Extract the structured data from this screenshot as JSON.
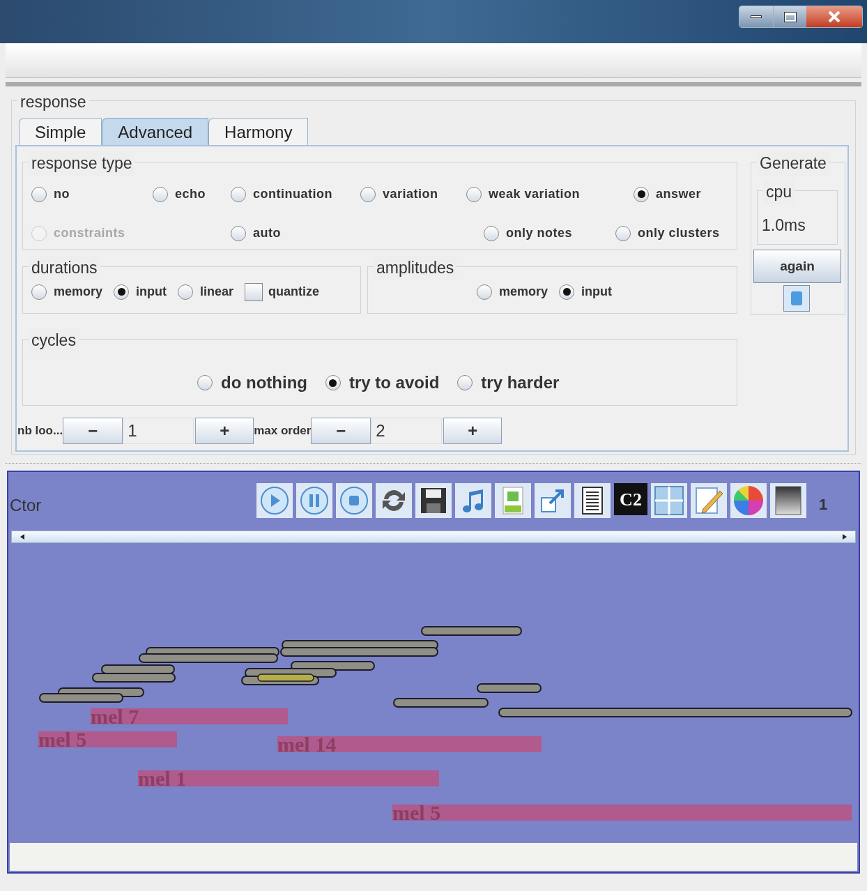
{
  "response": {
    "title": "response",
    "tabs": [
      {
        "label": "Simple",
        "selected": false
      },
      {
        "label": "Advanced",
        "selected": true
      },
      {
        "label": "Harmony",
        "selected": false
      }
    ],
    "response_type": {
      "title": "response type",
      "options": [
        {
          "label": "no",
          "selected": false,
          "disabled": false
        },
        {
          "label": "echo",
          "selected": false,
          "disabled": false
        },
        {
          "label": "continuation",
          "selected": false,
          "disabled": false
        },
        {
          "label": "variation",
          "selected": false,
          "disabled": false
        },
        {
          "label": "weak variation",
          "selected": false,
          "disabled": false
        },
        {
          "label": "answer",
          "selected": true,
          "disabled": false
        },
        {
          "label": "constraints",
          "selected": false,
          "disabled": true
        },
        {
          "label": "auto",
          "selected": false,
          "disabled": false
        },
        {
          "label": "only notes",
          "selected": false,
          "disabled": false
        },
        {
          "label": "only clusters",
          "selected": false,
          "disabled": false
        }
      ]
    },
    "durations": {
      "title": "durations",
      "options": [
        {
          "kind": "radio",
          "label": "memory",
          "selected": false
        },
        {
          "kind": "radio",
          "label": "input",
          "selected": true
        },
        {
          "kind": "radio",
          "label": "linear",
          "selected": false
        },
        {
          "kind": "checkbox",
          "label": "quantize",
          "checked": false
        }
      ]
    },
    "amplitudes": {
      "title": "amplitudes",
      "options": [
        {
          "label": "memory",
          "selected": false
        },
        {
          "label": "input",
          "selected": true
        }
      ]
    },
    "generate": {
      "title": "Generate",
      "cpu_title": "cpu",
      "cpu_value": "1.0ms",
      "again_button": "again"
    },
    "cycles": {
      "title": "cycles",
      "options": [
        {
          "label": "do nothing",
          "selected": false
        },
        {
          "label": "try to avoid",
          "selected": true
        },
        {
          "label": "try harder",
          "selected": false
        }
      ]
    },
    "spinners": [
      {
        "label": "nb loo...",
        "minus": "−",
        "value": "1",
        "plus": "+"
      },
      {
        "label": "max order",
        "minus": "−",
        "value": "2",
        "plus": "+"
      }
    ]
  },
  "player": {
    "title": "Ctor",
    "c2_icon_text": "C2",
    "counter": "1",
    "melodies": [
      {
        "label": "mel 7"
      },
      {
        "label": "mel 5"
      },
      {
        "label": "mel 14"
      },
      {
        "label": "mel 1"
      },
      {
        "label": "mel 5"
      }
    ]
  }
}
